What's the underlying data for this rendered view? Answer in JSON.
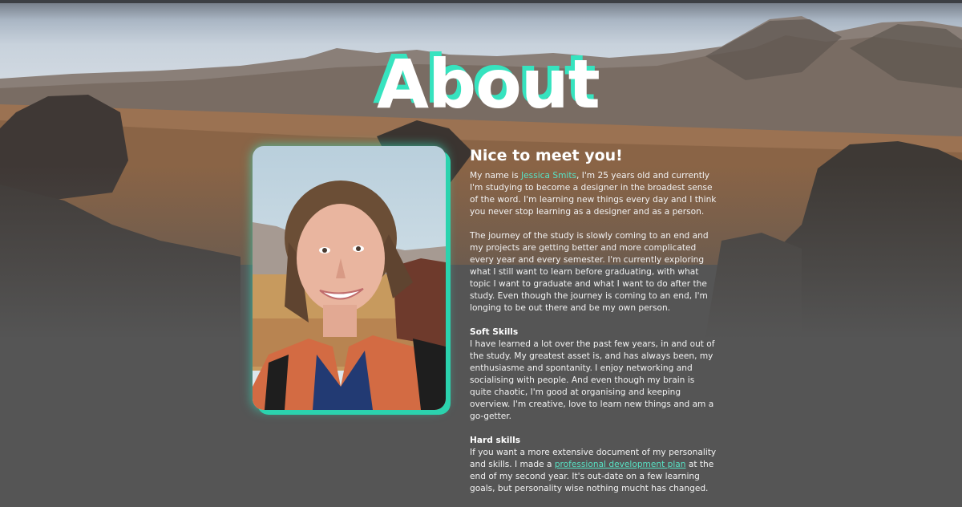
{
  "page": {
    "title": "About"
  },
  "photo": {
    "alt": "Portrait of Jessica Smits"
  },
  "intro": {
    "heading": "Nice to meet you!",
    "p1_before": "My name is ",
    "name": "Jessica Smits",
    "p1_after": ", I'm 25 years old and currently I'm studying to become a designer in the broadest sense of the word. I'm learning new things every day and I think you never stop learning as a designer and as a person.",
    "p2": "The journey of the study is slowly coming to an end and my projects are getting better and more complicated every year and every semester. I'm currently exploring what I still want to learn before graduating, with what topic I want to graduate and what I want to do after the study. Even though the journey is coming to an end, I'm longing to be out there and be my own person."
  },
  "soft_skills": {
    "heading": "Soft Skills",
    "text": "I have learned a lot over the past few years, in and out of the study. My greatest asset is, and has always been, my enthusiasme and spontanity. I enjoy networking and socialising with people. And even though my brain is quite chaotic, I'm good at organising and keeping overview. I'm creative, love to learn new things and am a go-getter."
  },
  "hard_skills": {
    "heading": "Hard skills",
    "text_before": "If you want a more extensive document of my personality and skills. I made a ",
    "link_label": "professional development plan",
    "text_after": " at the end of my second year. It's out-date on a few learning goals, but personality wise nothing mucht has changed."
  },
  "colors": {
    "accent": "#36e3bf",
    "background": "#555555",
    "link": "#57e2c4"
  }
}
